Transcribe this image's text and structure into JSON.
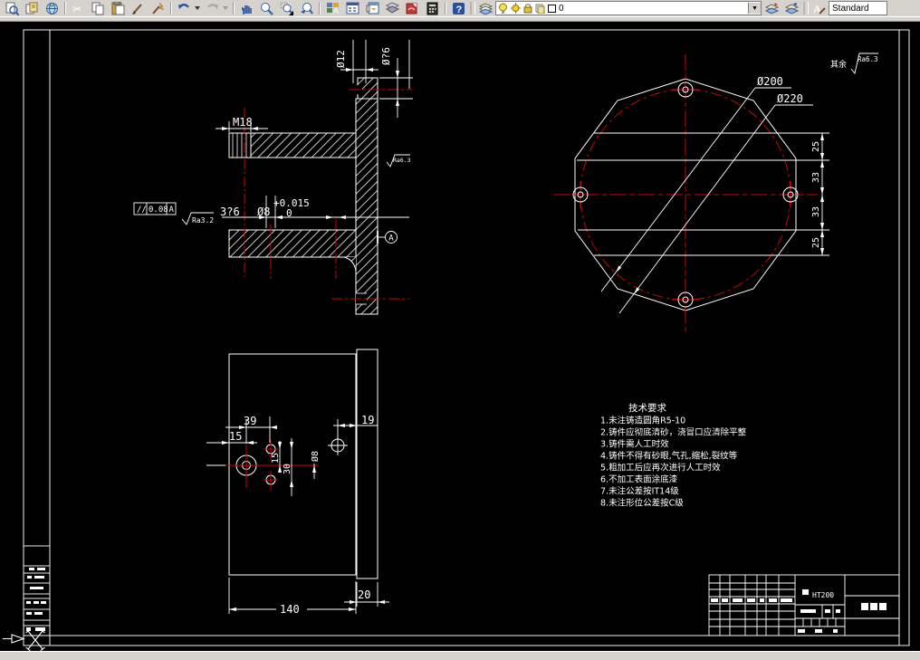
{
  "toolbar": {
    "layer_combo_value": "0",
    "style_combo_value": "Standard",
    "buttons": [
      "print-preview",
      "publish",
      "publish-to-web",
      "cut",
      "copy",
      "paste",
      "match-brush",
      "match-properties",
      "undo",
      "redo",
      "pan-realtime",
      "zoom-realtime",
      "zoom-window",
      "zoom-previous",
      "properties",
      "design-center",
      "tool-palettes",
      "sheet-set-manager",
      "markup-set-manager",
      "quick-calc",
      "help",
      "layer-properties-manager",
      "make-object-layer-current",
      "layer-previous",
      "text-style-manager"
    ]
  },
  "drawing": {
    "corner_note": {
      "prefix": "其余",
      "value": "Ra6.3"
    },
    "section": {
      "m18": "M18",
      "d12": "Ø12",
      "d26": "Ø?6",
      "len": "3?6",
      "d8": "Ø8",
      "tol_up": "+0.015",
      "tol_lo": "0",
      "gdt_sym": "//",
      "gdt_tol": "0.08",
      "gdt_datum": "A",
      "ra1": "Ra3.2",
      "ra2": "Ra6.3",
      "datum": "A"
    },
    "circular": {
      "d200": "Ø200",
      "d220": "Ø220",
      "s1": "25",
      "s2": "33",
      "s3": "33",
      "s4": "25"
    },
    "plan": {
      "w39": "39",
      "w15": "15",
      "w19": "19",
      "h15": "15",
      "h30": "30",
      "d8": "Ø8",
      "w140": "140",
      "w20": "20"
    },
    "tech": {
      "title": "技术要求",
      "items": [
        "1.未注铸造圆角R5-10",
        "2.铸件应彻底清砂，浇冒口应清除平整",
        "3.铸件需人工时效",
        "4.铸件不得有砂眼,气孔,缩松,裂纹等",
        "5.粗加工后应再次进行人工时效",
        "6.不加工表面涂底漆",
        "7.未注公差按IT14级",
        "8.未注形位公差按C级"
      ]
    },
    "title_block": {
      "material": "HT200"
    }
  }
}
